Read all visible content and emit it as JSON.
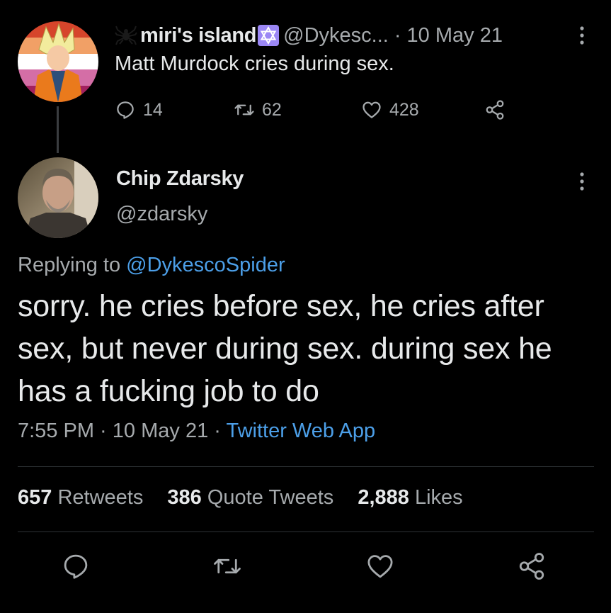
{
  "parent_tweet": {
    "author_name": "miri's island",
    "author_handle": "@Dykesc...",
    "separator": "·",
    "date": "10 May 21",
    "text": "Matt Murdock cries during sex.",
    "reply_count": "14",
    "retweet_count": "62",
    "like_count": "428"
  },
  "main_tweet": {
    "author_name": "Chip Zdarsky",
    "author_handle": "@zdarsky",
    "replying_prefix": "Replying to ",
    "replying_to": "@DykescoSpider",
    "text": "sorry. he cries before sex, he cries after sex, but never during sex. during sex he has a fucking job to do",
    "time": "7:55 PM",
    "meta_sep1": " · ",
    "date": "10 May 21",
    "meta_sep2": " · ",
    "source": "Twitter Web App"
  },
  "stats": {
    "retweets_count": "657",
    "retweets_label": "Retweets",
    "quote_count": "386",
    "quote_label": "Quote Tweets",
    "likes_count": "2,888",
    "likes_label": "Likes"
  },
  "icons": {
    "reply": "reply-icon",
    "retweet": "retweet-icon",
    "like": "heart-icon",
    "share": "share-icon",
    "more": "more-vertical-icon",
    "spider": "spider-icon",
    "star": "star-of-david-icon"
  },
  "colors": {
    "background": "#000000",
    "text_primary": "#e7e9ea",
    "text_secondary": "#a6aaad",
    "link": "#4c9fe8",
    "divider": "#2f3336",
    "star_badge": "#9b87f5"
  }
}
